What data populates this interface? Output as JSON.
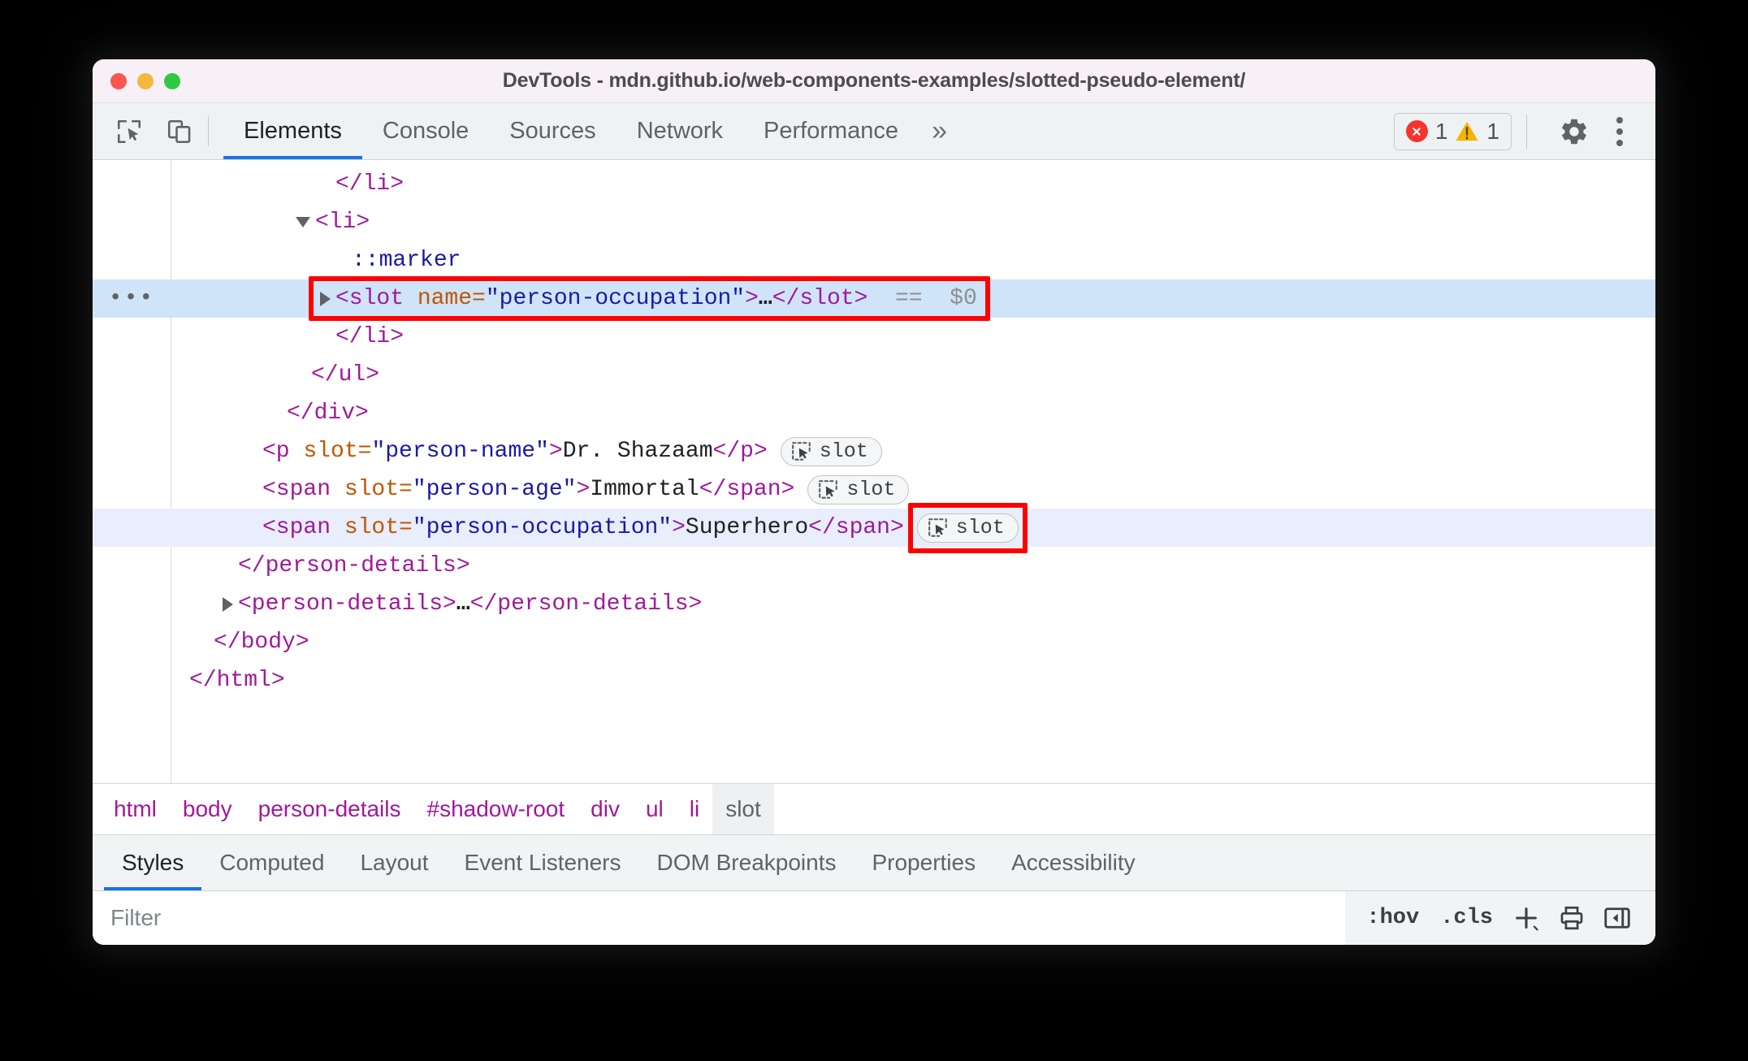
{
  "window": {
    "title": "DevTools - mdn.github.io/web-components-examples/slotted-pseudo-element/",
    "traffic_lights": [
      "close",
      "minimize",
      "zoom"
    ]
  },
  "toolbar": {
    "inspect_icon": "inspect-element-icon",
    "device_icon": "device-toolbar-icon",
    "tabs": [
      {
        "label": "Elements",
        "active": true
      },
      {
        "label": "Console",
        "active": false
      },
      {
        "label": "Sources",
        "active": false
      },
      {
        "label": "Network",
        "active": false
      },
      {
        "label": "Performance",
        "active": false
      }
    ],
    "more_tabs_label": "»",
    "issues": {
      "error_glyph": "✕",
      "error_count": "1",
      "warning_count": "1",
      "error_color": "#f4352f",
      "warning_color": "#f5b400"
    },
    "settings_icon": "gear-icon",
    "menu_icon": "kebab-menu-icon"
  },
  "dom_tree": {
    "rows": [
      {
        "id": "row-li-close-1",
        "indent": 170,
        "twisty": "none",
        "parts": [
          {
            "t": "tag",
            "s": "</li>"
          }
        ]
      },
      {
        "id": "row-li-open",
        "indent": 140,
        "twisty": "down",
        "parts": [
          {
            "t": "tag",
            "s": "<li>"
          }
        ]
      },
      {
        "id": "row-marker",
        "indent": 190,
        "twisty": "none",
        "parts": [
          {
            "t": "pseudo",
            "s": "::marker"
          }
        ]
      },
      {
        "id": "row-slot-selected",
        "indent": 170,
        "twisty": "right",
        "selected": true,
        "gutter": "•••",
        "highlight_box": true,
        "parts": [
          {
            "t": "tag",
            "s": "<slot "
          },
          {
            "t": "attr",
            "s": "name="
          },
          {
            "t": "val",
            "s": "\"person-occupation\""
          },
          {
            "t": "tag",
            "s": ">"
          },
          {
            "t": "ellip",
            "s": "…"
          },
          {
            "t": "tag",
            "s": "</slot>"
          },
          {
            "t": "dollar",
            "s": "  ==  $0"
          }
        ]
      },
      {
        "id": "row-li-close-2",
        "indent": 170,
        "twisty": "none",
        "parts": [
          {
            "t": "tag",
            "s": "</li>"
          }
        ]
      },
      {
        "id": "row-ul-close",
        "indent": 140,
        "twisty": "none",
        "parts": [
          {
            "t": "tag",
            "s": "</ul>"
          }
        ]
      },
      {
        "id": "row-div-close",
        "indent": 110,
        "twisty": "none",
        "parts": [
          {
            "t": "tag",
            "s": "</div>"
          }
        ]
      },
      {
        "id": "row-p-person-name",
        "indent": 80,
        "twisty": "none",
        "badge": "slot",
        "parts": [
          {
            "t": "tag",
            "s": "<p "
          },
          {
            "t": "attr",
            "s": "slot="
          },
          {
            "t": "val",
            "s": "\"person-name\""
          },
          {
            "t": "tag",
            "s": ">"
          },
          {
            "t": "txt",
            "s": "Dr. Shazaam"
          },
          {
            "t": "tag",
            "s": "</p>"
          }
        ]
      },
      {
        "id": "row-span-person-age",
        "indent": 80,
        "twisty": "none",
        "badge": "slot",
        "parts": [
          {
            "t": "tag",
            "s": "<span "
          },
          {
            "t": "attr",
            "s": "slot="
          },
          {
            "t": "val",
            "s": "\"person-age\""
          },
          {
            "t": "tag",
            "s": ">"
          },
          {
            "t": "txt",
            "s": "Immortal"
          },
          {
            "t": "tag",
            "s": "</span>"
          }
        ]
      },
      {
        "id": "row-span-person-occupation",
        "indent": 80,
        "twisty": "none",
        "soft_selected": true,
        "badge": "slot",
        "badge_highlight": true,
        "parts": [
          {
            "t": "tag",
            "s": "<span "
          },
          {
            "t": "attr",
            "s": "slot="
          },
          {
            "t": "val",
            "s": "\"person-occupation\""
          },
          {
            "t": "tag",
            "s": ">"
          },
          {
            "t": "txt",
            "s": "Superhero"
          },
          {
            "t": "tag",
            "s": "</span>"
          }
        ]
      },
      {
        "id": "row-person-details-close",
        "indent": 50,
        "twisty": "none",
        "parts": [
          {
            "t": "tag",
            "s": "</person-details>"
          }
        ]
      },
      {
        "id": "row-person-details-collapsed",
        "indent": 50,
        "twisty": "right",
        "parts": [
          {
            "t": "tag",
            "s": "<person-details>"
          },
          {
            "t": "ellip",
            "s": "…"
          },
          {
            "t": "tag",
            "s": "</person-details>"
          }
        ]
      },
      {
        "id": "row-body-close",
        "indent": 20,
        "twisty": "none",
        "parts": [
          {
            "t": "tag",
            "s": "</body>"
          }
        ]
      },
      {
        "id": "row-html-close",
        "indent": -10,
        "twisty": "none",
        "parts": [
          {
            "t": "tag",
            "s": "</html>"
          }
        ]
      }
    ],
    "badge_label": "slot"
  },
  "breadcrumb": {
    "items": [
      {
        "label": "html",
        "active": false
      },
      {
        "label": "body",
        "active": false
      },
      {
        "label": "person-details",
        "active": false
      },
      {
        "label": "#shadow-root",
        "active": false
      },
      {
        "label": "div",
        "active": false
      },
      {
        "label": "ul",
        "active": false
      },
      {
        "label": "li",
        "active": false
      },
      {
        "label": "slot",
        "active": true
      }
    ]
  },
  "sidebar_tabs": {
    "items": [
      {
        "label": "Styles",
        "active": true
      },
      {
        "label": "Computed",
        "active": false
      },
      {
        "label": "Layout",
        "active": false
      },
      {
        "label": "Event Listeners",
        "active": false
      },
      {
        "label": "DOM Breakpoints",
        "active": false
      },
      {
        "label": "Properties",
        "active": false
      },
      {
        "label": "Accessibility",
        "active": false
      }
    ]
  },
  "filter_bar": {
    "placeholder": "Filter",
    "value": "",
    "hov_label": ":hov",
    "cls_label": ".cls",
    "new_rule_icon": "plus-icon",
    "computed_icon": "print-style-icon",
    "sidebar_toggle_icon": "show-sidebar-icon"
  },
  "colors": {
    "accent": "#1a73e8",
    "tag": "#a0199b",
    "attr_name": "#c05600",
    "attr_value": "#1a1aa6",
    "selection": "#cfe4f8",
    "highlight_box": "#ff0000",
    "titlebar_bg": "#f7f0f7"
  }
}
